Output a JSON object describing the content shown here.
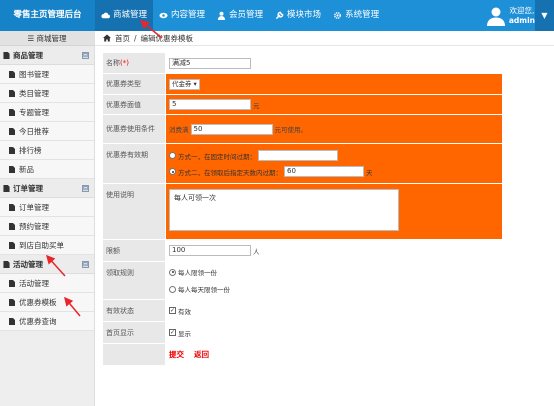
{
  "header": {
    "brand": "零售主页管理后台",
    "tabs": [
      {
        "label": "商城管理",
        "icon": "cloud-icon",
        "active": true
      },
      {
        "label": "内容管理",
        "icon": "eye-icon",
        "active": false
      },
      {
        "label": "会员管理",
        "icon": "user-icon",
        "active": false
      },
      {
        "label": "模块市场",
        "icon": "wrench-icon",
        "active": false
      },
      {
        "label": "系统管理",
        "icon": "gear-icon",
        "active": false
      }
    ],
    "user": {
      "greeting": "欢迎您,",
      "name": "admin"
    },
    "dropdown_icon": "caret-down-icon"
  },
  "sidebar": {
    "title": "商城管理",
    "groups": [
      {
        "label": "商品管理",
        "items": [
          "图书管理",
          "类目管理",
          "专题管理",
          "今日推荐",
          "排行榜",
          "新品"
        ]
      },
      {
        "label": "订单管理",
        "items": [
          "订单管理",
          "预约管理",
          "到店自助买单"
        ]
      },
      {
        "label": "活动管理",
        "items": [
          "活动管理",
          "优惠券模板",
          "优惠券查询"
        ]
      }
    ],
    "collapse_glyph": "⊟"
  },
  "breadcrumb": {
    "home": "首页",
    "separator": "/",
    "current": "编辑优惠券模板"
  },
  "form": {
    "name_label": "名称",
    "name_required": "(*)",
    "name_value": "满减5",
    "type_label": "优惠券类型",
    "type_value": "代金券",
    "face_label": "优惠券面值",
    "face_value": "5",
    "face_unit": "元",
    "cond_label": "优惠券使用条件",
    "cond_prefix": "消费满",
    "cond_value": "50",
    "cond_suffix": "元可使用。",
    "validity_label": "优惠券有效期",
    "validity_opt1": "方式一，在固定时间过期：",
    "validity_opt1_value": "",
    "validity_opt2": "方式二，在领取后指定天数内过期：",
    "validity_opt2_value": "60",
    "validity_unit": "天",
    "desc_label": "使用说明",
    "desc_value": "每人可领一次",
    "limit_label": "限额",
    "limit_value": "100",
    "limit_unit": "人",
    "rule_label": "领取规则",
    "rule_opt1": "每人限领一份",
    "rule_opt2": "每人每天限领一份",
    "status_label": "有效状态",
    "status_value": "有效",
    "homepage_label": "首页显示",
    "homepage_value": "显示",
    "submit_label": "提交",
    "back_label": "返回"
  },
  "colors": {
    "topbar": "#1e90d8",
    "highlight": "#ff6600",
    "annotation": "#e8262b",
    "link": "#ee0000"
  }
}
